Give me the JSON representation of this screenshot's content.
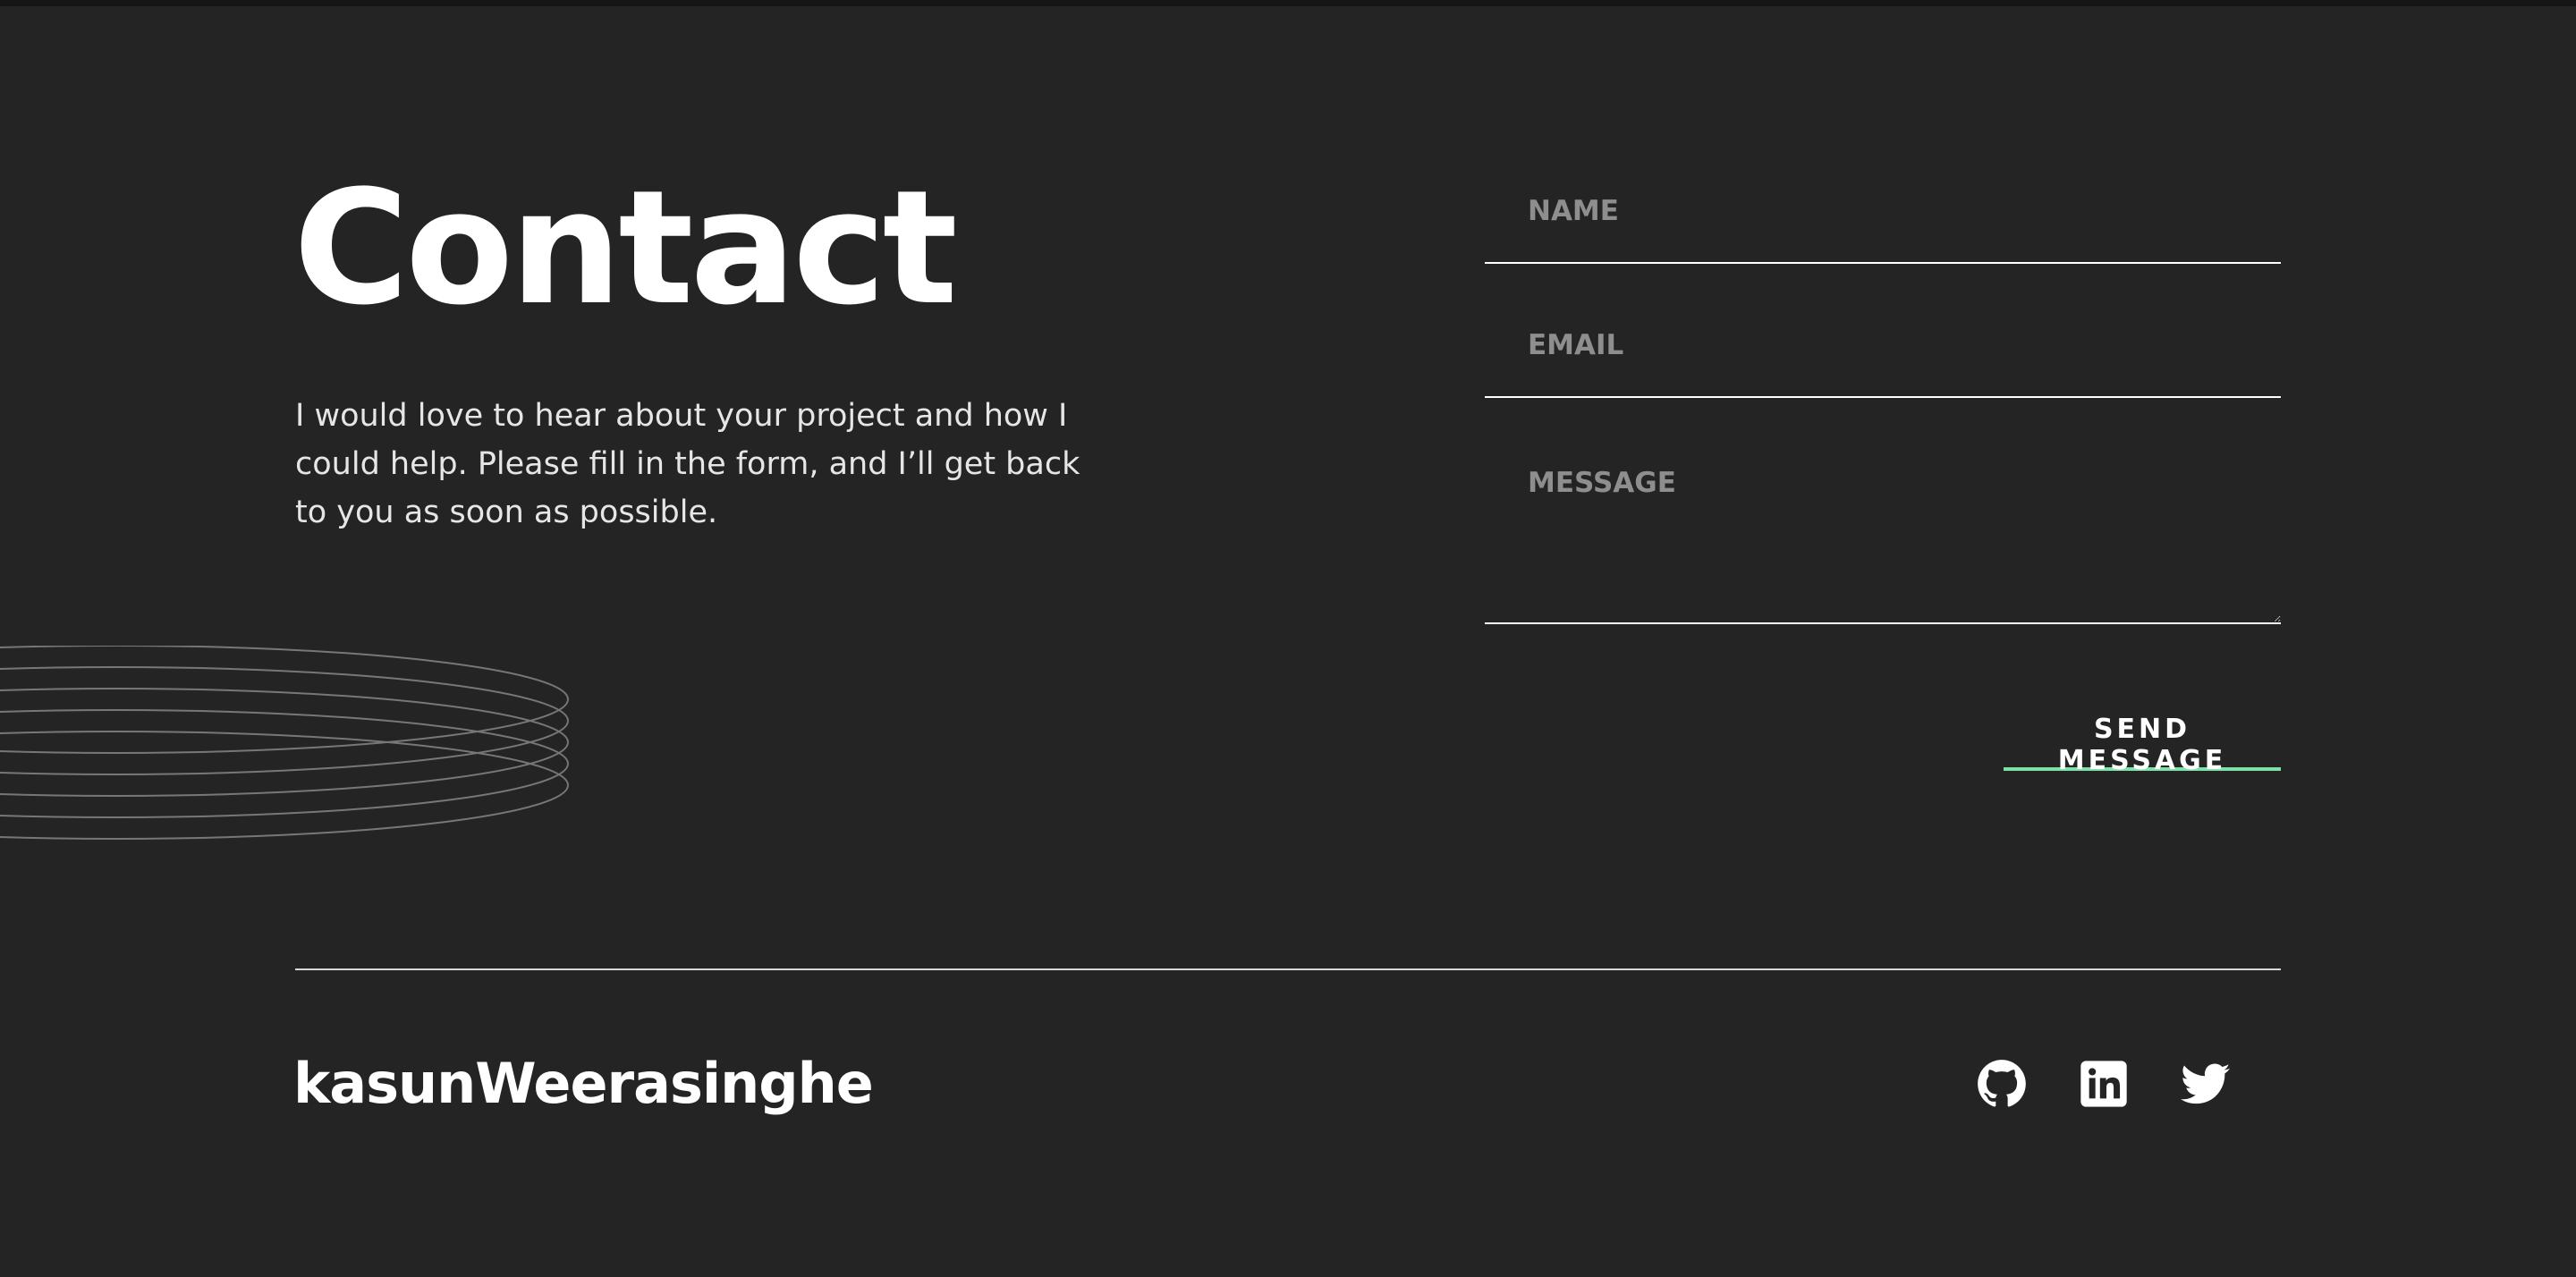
{
  "contact": {
    "title": "Contact",
    "intro": "I would love to hear about your project and how I could help. Please fill in the form, and I’ll get back to you as soon as possible."
  },
  "form": {
    "name_placeholder": "NAME",
    "email_placeholder": "EMAIL",
    "message_placeholder": "MESSAGE",
    "name_value": "",
    "email_value": "",
    "message_value": "",
    "submit_label": "SEND MESSAGE"
  },
  "footer": {
    "brand": "kasunWeerasinghe",
    "social": [
      {
        "icon": "github-icon"
      },
      {
        "icon": "linkedin-icon"
      },
      {
        "icon": "twitter-icon"
      }
    ]
  },
  "colors": {
    "background": "#242424",
    "text": "#ffffff",
    "muted_text": "#8e8e8e",
    "accent": "#7ee2a8"
  }
}
